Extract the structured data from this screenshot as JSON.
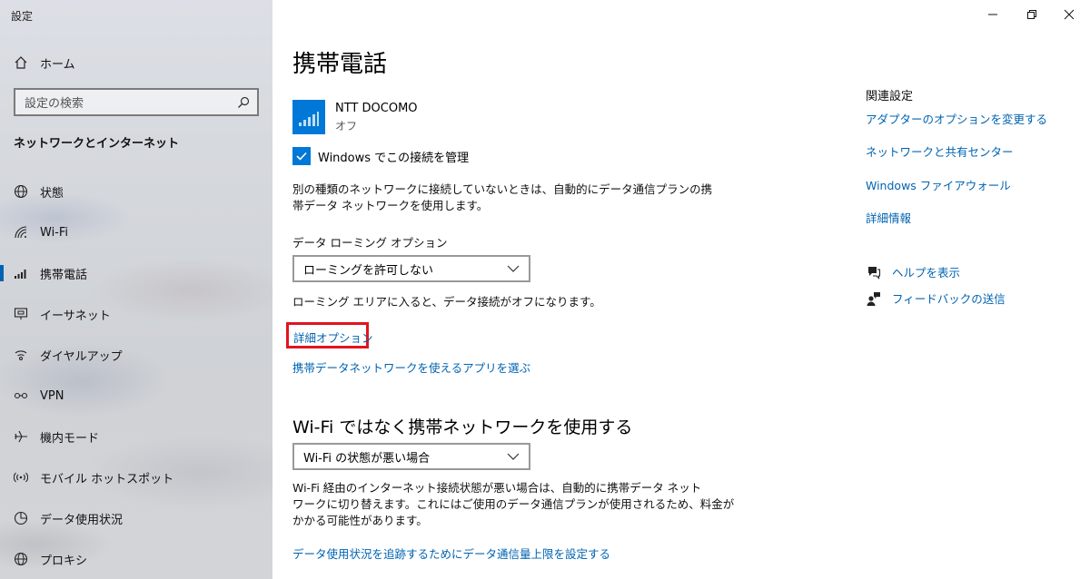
{
  "window": {
    "title": "設定"
  },
  "sidebar": {
    "home_label": "ホーム",
    "search_placeholder": "設定の検索",
    "section_heading": "ネットワークとインターネット",
    "items": [
      {
        "label": "状態",
        "icon": "globe-icon"
      },
      {
        "label": "Wi-Fi",
        "icon": "wifi-icon"
      },
      {
        "label": "携帯電話",
        "icon": "cellular-icon"
      },
      {
        "label": "イーサネット",
        "icon": "ethernet-icon"
      },
      {
        "label": "ダイヤルアップ",
        "icon": "dialup-icon"
      },
      {
        "label": "VPN",
        "icon": "vpn-icon"
      },
      {
        "label": "機内モード",
        "icon": "airplane-icon"
      },
      {
        "label": "モバイル ホットスポット",
        "icon": "hotspot-icon"
      },
      {
        "label": "データ使用状況",
        "icon": "data-usage-icon"
      },
      {
        "label": "プロキシ",
        "icon": "proxy-icon"
      }
    ],
    "active_item": "携帯電話"
  },
  "main": {
    "title": "携帯電話",
    "carrier": {
      "name": "NTT DOCOMO",
      "status": "オフ"
    },
    "manage_checkbox": {
      "label": "Windows でこの接続を管理",
      "checked": true
    },
    "description_line1": "別の種類のネットワークに接続していないときは、自動的にデータ通信プランの携",
    "description_line2": "帯データ ネットワークを使用します。",
    "roaming_label": "データ ローミング オプション",
    "roaming_value": "ローミングを許可しない",
    "roaming_note": "ローミング エリアに入ると、データ接続がオフになります。",
    "advanced_options_link": "詳細オプション",
    "choose_apps_link": "携帯データネットワークを使えるアプリを選ぶ",
    "wifi_section_title": "Wi-Fi ではなく携帯ネットワークを使用する",
    "wifi_dropdown_value": "Wi-Fi の状態が悪い場合",
    "wifi_desc_line1": "Wi-Fi 経由のインターネット接続状態が悪い場合は、自動的に携帯データ ネット",
    "wifi_desc_line2": "ワークに切り替えます。これにはご使用のデータ通信プランが使用されるため、料金が",
    "wifi_desc_line3": "かかる可能性があります。",
    "data_limit_link": "データ使用状況を追跡するためにデータ通信量上限を設定する"
  },
  "related": {
    "title": "関連設定",
    "links": [
      "アダプターのオプションを変更する",
      "ネットワークと共有センター",
      "Windows ファイアウォール",
      "詳細情報"
    ],
    "help_label": "ヘルプを表示",
    "feedback_label": "フィードバックの送信"
  },
  "colors": {
    "accent": "#0078d7",
    "link": "#0063b1",
    "highlight": "#e0141f"
  }
}
